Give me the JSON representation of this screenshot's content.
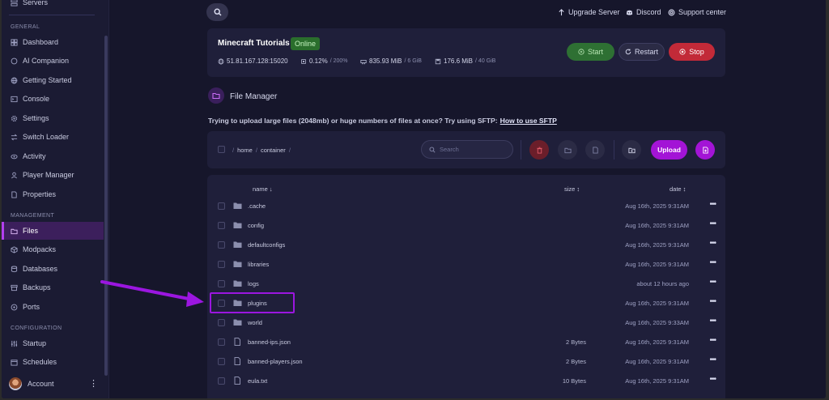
{
  "sidebar": {
    "top_item": "Servers",
    "sections": [
      {
        "heading": "GENERAL",
        "items": [
          {
            "label": "Dashboard",
            "icon": "dashboard-icon"
          },
          {
            "label": "AI Companion",
            "icon": "chat-icon"
          },
          {
            "label": "Getting Started",
            "icon": "globe-icon"
          },
          {
            "label": "Console",
            "icon": "terminal-icon"
          },
          {
            "label": "Settings",
            "icon": "gear-icon"
          },
          {
            "label": "Switch Loader",
            "icon": "switch-icon"
          },
          {
            "label": "Activity",
            "icon": "eye-icon"
          },
          {
            "label": "Player Manager",
            "icon": "user-icon"
          },
          {
            "label": "Properties",
            "icon": "document-icon"
          }
        ]
      },
      {
        "heading": "MANAGEMENT",
        "items": [
          {
            "label": "Files",
            "icon": "folder-icon",
            "active": true
          },
          {
            "label": "Modpacks",
            "icon": "box-icon"
          },
          {
            "label": "Databases",
            "icon": "database-icon"
          },
          {
            "label": "Backups",
            "icon": "archive-icon"
          },
          {
            "label": "Ports",
            "icon": "network-icon"
          }
        ]
      },
      {
        "heading": "CONFIGURATION",
        "items": [
          {
            "label": "Startup",
            "icon": "sliders-icon"
          },
          {
            "label": "Schedules",
            "icon": "calendar-icon"
          }
        ]
      }
    ],
    "account": {
      "label": "Account",
      "menu": "⋮"
    }
  },
  "topbar": {
    "links": [
      {
        "label": "Upgrade Server",
        "icon": "arrow-up-icon"
      },
      {
        "label": "Discord",
        "icon": "discord-icon"
      },
      {
        "label": "Support center",
        "icon": "lifebuoy-icon"
      }
    ]
  },
  "server": {
    "name": "Minecraft Tutorials",
    "status": "Online",
    "address": "51.81.167.128:15020",
    "cpu": "0.12%",
    "cpu_max": "/ 200%",
    "memory": "835.93 MiB",
    "memory_max": "/ 6 GiB",
    "disk": "176.6 MiB",
    "disk_max": "/ 40 GiB",
    "buttons": {
      "start": "Start",
      "restart": "Restart",
      "stop": "Stop"
    }
  },
  "file_manager": {
    "title": "File Manager",
    "sftp_note": "Trying to upload large files (2048mb) or huge numbers of files at once? Try using SFTP:",
    "sftp_link": "How to use SFTP",
    "breadcrumb": [
      "home",
      "container"
    ],
    "search_placeholder": "Search",
    "upload_label": "Upload",
    "columns": {
      "name": "name ↓",
      "size": "size ↕",
      "date": "date ↕"
    },
    "files": [
      {
        "name": ".cache",
        "type": "folder",
        "size": "",
        "date": "Aug 16th, 2025 9:31AM"
      },
      {
        "name": "config",
        "type": "folder",
        "size": "",
        "date": "Aug 16th, 2025 9:31AM"
      },
      {
        "name": "defaultconfigs",
        "type": "folder",
        "size": "",
        "date": "Aug 16th, 2025 9:31AM"
      },
      {
        "name": "libraries",
        "type": "folder",
        "size": "",
        "date": "Aug 16th, 2025 9:31AM"
      },
      {
        "name": "logs",
        "type": "folder",
        "size": "",
        "date": "about 12 hours ago"
      },
      {
        "name": "plugins",
        "type": "folder",
        "size": "",
        "date": "Aug 16th, 2025 9:31AM"
      },
      {
        "name": "world",
        "type": "folder",
        "size": "",
        "date": "Aug 16th, 2025 9:33AM"
      },
      {
        "name": "banned-ips.json",
        "type": "file",
        "size": "2 Bytes",
        "date": "Aug 16th, 2025 9:31AM"
      },
      {
        "name": "banned-players.json",
        "type": "file",
        "size": "2 Bytes",
        "date": "Aug 16th, 2025 9:31AM"
      },
      {
        "name": "eula.txt",
        "type": "file",
        "size": "10 Bytes",
        "date": "Aug 16th, 2025 9:31AM"
      }
    ],
    "row_menu": "•••"
  },
  "colors": {
    "accent": "#a314d6",
    "highlight": "#9b16e0",
    "start": "#2e7033",
    "stop": "#c22a38",
    "background": "#16162b",
    "card": "#1f1f3a"
  }
}
